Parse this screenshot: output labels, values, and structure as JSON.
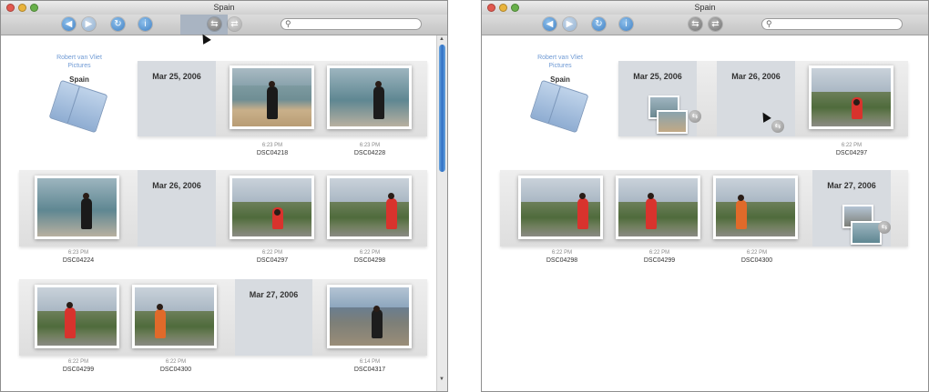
{
  "windows": [
    {
      "title": "Spain",
      "source": {
        "name_line1": "Robert van Vliet",
        "name_line2": "Pictures",
        "label": "Spain"
      },
      "dates": [
        "Mar 25, 2006",
        "Mar 26, 2006",
        "Mar 27, 2006"
      ],
      "photos": [
        {
          "time": "6:23 PM",
          "file": "DSC04218"
        },
        {
          "time": "6:23 PM",
          "file": "DSC04228"
        },
        {
          "time": "6:23 PM",
          "file": "DSC04224"
        },
        {
          "time": "6:22 PM",
          "file": "DSC04297"
        },
        {
          "time": "6:22 PM",
          "file": "DSC04298"
        },
        {
          "time": "6:22 PM",
          "file": "DSC04299"
        },
        {
          "time": "6:22 PM",
          "file": "DSC04300"
        },
        {
          "time": "6:14 PM",
          "file": "DSC04317"
        }
      ]
    },
    {
      "title": "Spain",
      "source": {
        "name_line1": "Robert van Vliet",
        "name_line2": "Pictures",
        "label": "Spain"
      },
      "dates": [
        "Mar 25, 2006",
        "Mar 26, 2006",
        "Mar 27, 2006"
      ],
      "photos": [
        {
          "time": "6:22 PM",
          "file": "DSC04297"
        },
        {
          "time": "6:22 PM",
          "file": "DSC04298"
        },
        {
          "time": "6:22 PM",
          "file": "DSC04299"
        },
        {
          "time": "6:22 PM",
          "file": "DSC04300"
        }
      ]
    }
  ],
  "icons": {
    "back": "back-arrow-icon",
    "forward": "forward-arrow-icon",
    "rotate": "rotate-icon",
    "info": "info-icon",
    "group": "group-icon",
    "ungroup": "ungroup-icon",
    "search": "magnifier-icon"
  },
  "colors": {
    "accent": "#3f7fc3",
    "date_card": "#d7dbe0",
    "source_text": "#6f9ad4"
  }
}
